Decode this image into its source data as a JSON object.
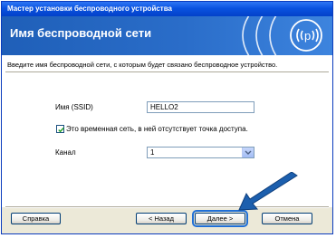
{
  "window": {
    "title": "Мастер установки беспроводного устройства"
  },
  "header": {
    "title": "Имя беспроводной сети"
  },
  "instruction": "Введите имя беспроводной сети, с которым будет связано беспроводное устройство.",
  "form": {
    "ssid_label": "Имя (SSID)",
    "ssid_value": "HELLO2",
    "adhoc_label": "Это временная сеть, в ней отсутствует точка доступа.",
    "adhoc_checked": true,
    "channel_label": "Канал",
    "channel_value": "1"
  },
  "buttons": {
    "help": "Справка",
    "back": "< Назад",
    "next": "Далее >",
    "cancel": "Отмена"
  },
  "colors": {
    "accent": "#1f5fb8",
    "annotation_arrow": "#1c5fae"
  },
  "icons": [
    "wireless-signal-icon",
    "checkmark-icon",
    "chevron-down-icon",
    "pointer-arrow-icon"
  ]
}
